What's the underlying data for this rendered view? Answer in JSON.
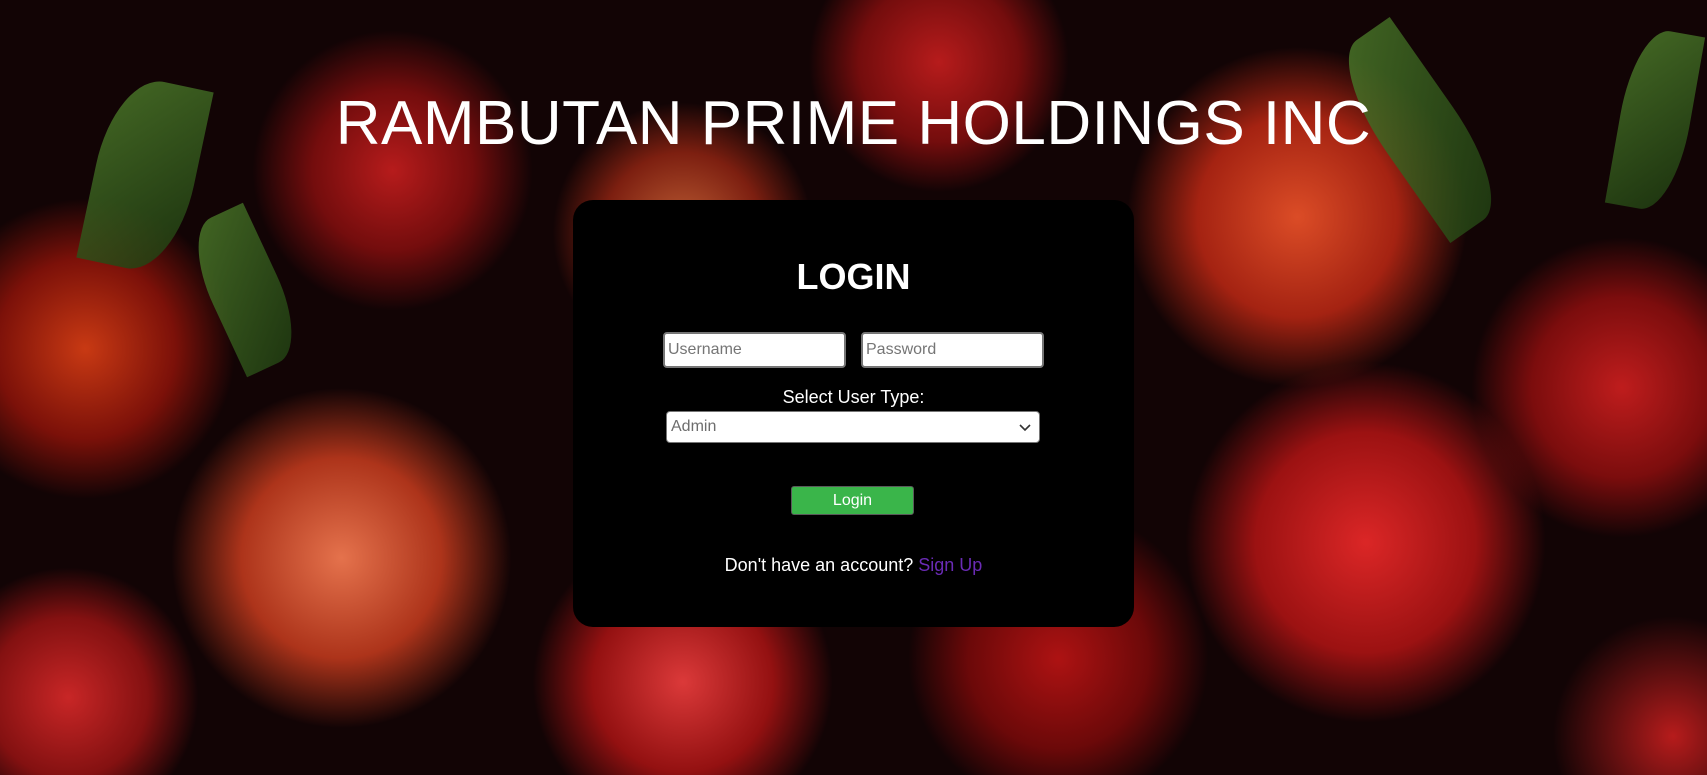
{
  "header": {
    "title": "RAMBUTAN PRIME HOLDINGS INC"
  },
  "login": {
    "heading": "LOGIN",
    "username_placeholder": "Username",
    "password_placeholder": "Password",
    "user_type_label": "Select User Type:",
    "user_type_selected": "Admin",
    "submit_label": "Login",
    "signup_prompt": "Don't have an account?",
    "signup_link": "Sign Up"
  },
  "colors": {
    "card_background": "#000000",
    "button_green": "#3ab54a",
    "link_purple": "#6a2bb5"
  },
  "icons": {
    "select_chevron": "chevron-down-icon"
  }
}
